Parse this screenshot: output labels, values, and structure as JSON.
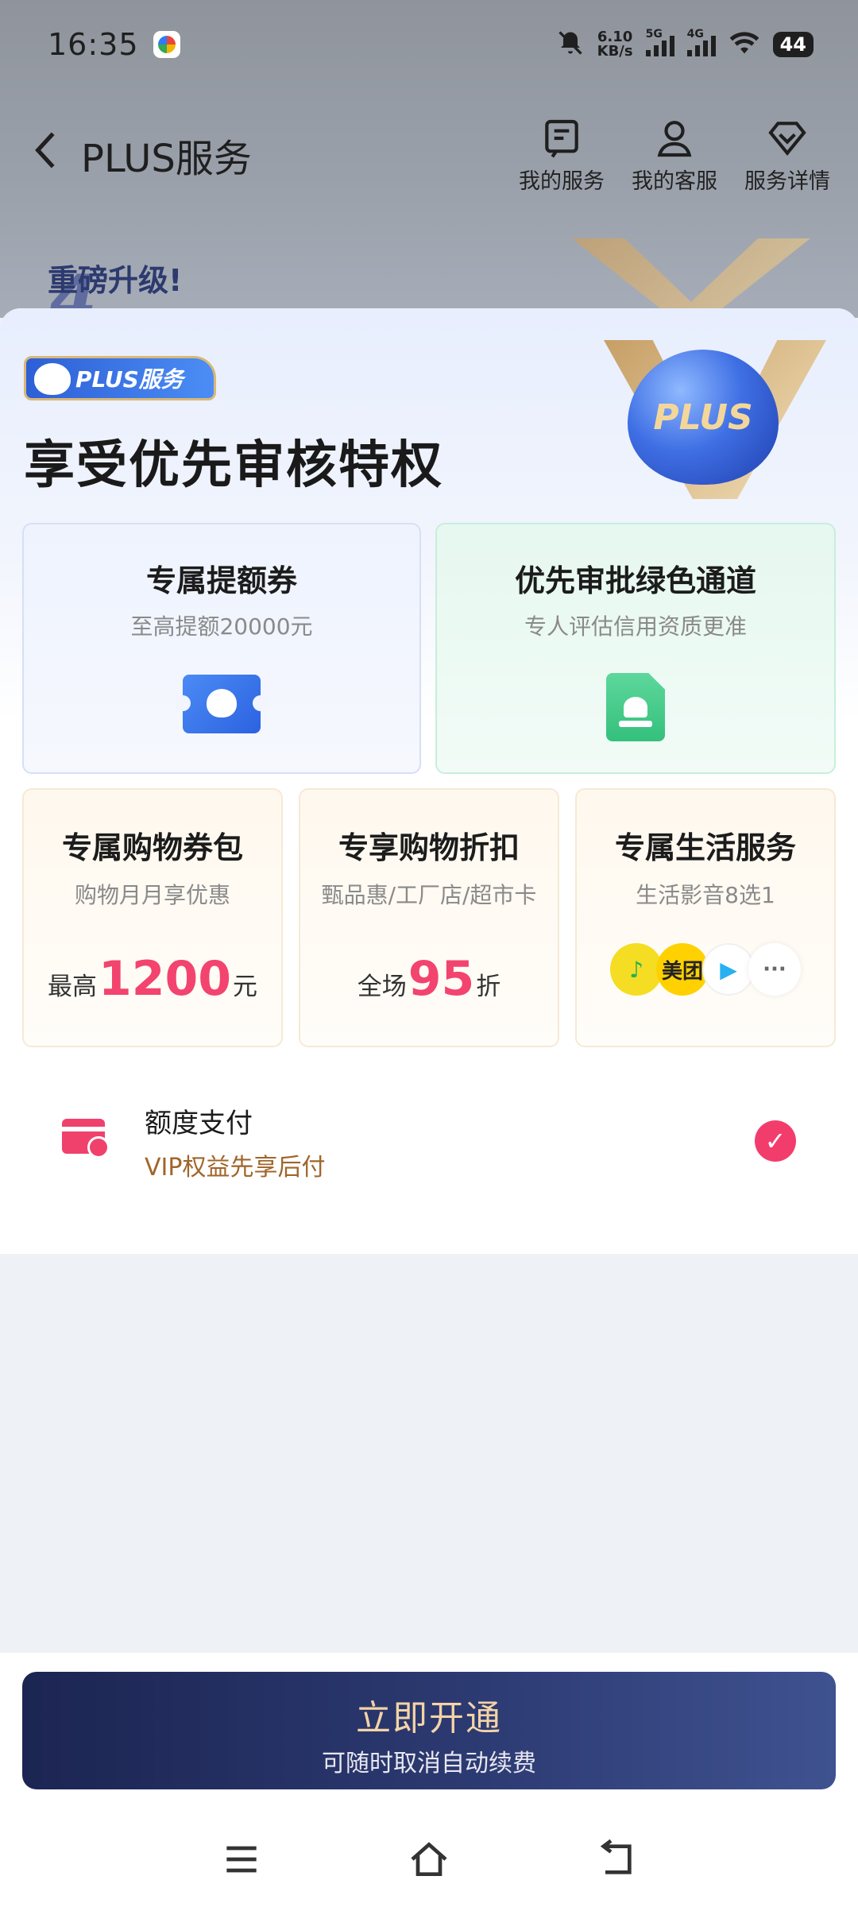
{
  "status_bar": {
    "time": "16:35",
    "net_speed_value": "6.10",
    "net_speed_unit": "KB/s",
    "signal1": "5G",
    "signal2": "4G",
    "battery": "44"
  },
  "header": {
    "back_icon": "chevron-left-icon",
    "title": "PLUS服务",
    "actions": [
      {
        "label": "我的服务",
        "icon": "list-doc-icon"
      },
      {
        "label": "我的客服",
        "icon": "agent-icon"
      },
      {
        "label": "服务详情",
        "icon": "diamond-icon"
      }
    ]
  },
  "banner_peek": {
    "text": "重磅升级!",
    "number": "4"
  },
  "sheet": {
    "badge": "PLUS服务",
    "hero_label": "PLUS",
    "title": "享受优先审核特权",
    "card1": {
      "title": "专属提额券",
      "subtitle": "至高提额20000元",
      "icon": "ticket-icon"
    },
    "card2": {
      "title": "优先审批绿色通道",
      "subtitle": "专人评估信用资质更准",
      "icon": "document-stamp-icon"
    },
    "card3": {
      "title": "专属购物券包",
      "subtitle": "购物月月享优惠",
      "price_prefix": "最高",
      "price_value": "1200",
      "price_suffix": "元"
    },
    "card4": {
      "title": "专享购物折扣",
      "subtitle": "甄品惠/工厂店/超市卡",
      "price_prefix": "全场",
      "price_value": "95",
      "price_suffix": "折"
    },
    "card5": {
      "title": "专属生活服务",
      "subtitle": "生活影音8选1",
      "apps": {
        "music": "♪",
        "meituan": "美团",
        "video": "▶",
        "more": "···"
      }
    },
    "payment": {
      "title": "额度支付",
      "subtitle": "VIP权益先享后付",
      "check": "✓",
      "selected": true
    }
  },
  "footer": {
    "cta_main": "立即开通",
    "cta_sub": "可随时取消自动续费"
  },
  "colors": {
    "accent_pink": "#f2446e",
    "cta_dark": "#1c2552",
    "cta_text": "#f4d3a6",
    "brown_text": "#a0652a"
  }
}
